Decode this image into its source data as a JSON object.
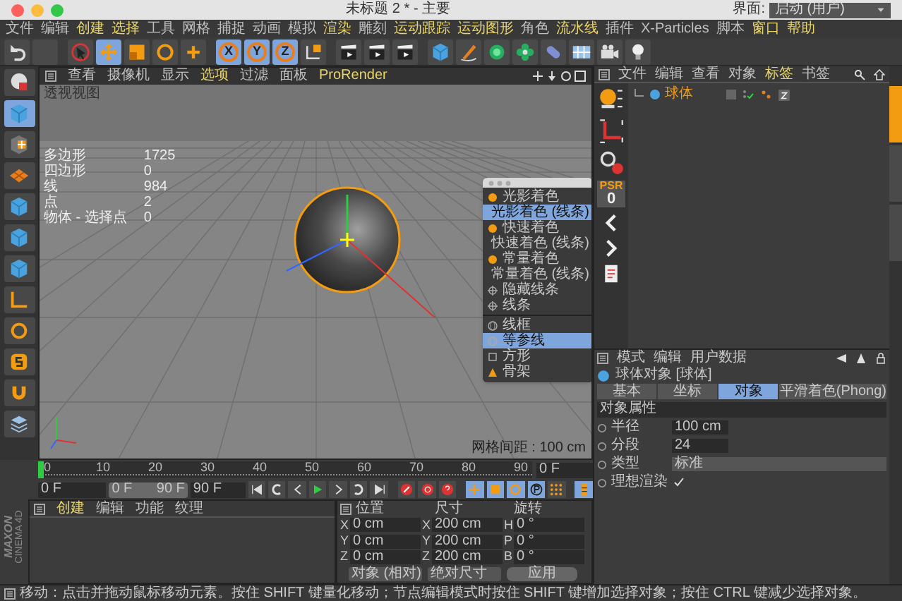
{
  "window": {
    "title": "未标题 2 * - 主要"
  },
  "menu": [
    {
      "label": "文件",
      "highlighted": false
    },
    {
      "label": "编辑",
      "highlighted": false
    },
    {
      "label": "创建",
      "highlighted": true
    },
    {
      "label": "选择",
      "highlighted": true
    },
    {
      "label": "工具",
      "highlighted": false
    },
    {
      "label": "网格",
      "highlighted": false
    },
    {
      "label": "捕捉",
      "highlighted": false
    },
    {
      "label": "动画",
      "highlighted": false
    },
    {
      "label": "模拟",
      "highlighted": false
    },
    {
      "label": "渲染",
      "highlighted": true
    },
    {
      "label": "雕刻",
      "highlighted": false
    },
    {
      "label": "运动跟踪",
      "highlighted": true
    },
    {
      "label": "运动图形",
      "highlighted": true
    },
    {
      "label": "角色",
      "highlighted": false
    },
    {
      "label": "流水线",
      "highlighted": true
    },
    {
      "label": "插件",
      "highlighted": false
    },
    {
      "label": "X-Particles",
      "highlighted": false
    },
    {
      "label": "脚本",
      "highlighted": false
    },
    {
      "label": "窗口",
      "highlighted": true
    },
    {
      "label": "帮助",
      "highlighted": true
    }
  ],
  "layout": {
    "label": "界面:",
    "value": "启动 (用户)"
  },
  "toolbar": [
    {
      "kind": "undo",
      "selected": false
    },
    {
      "kind": "blank",
      "selected": false
    },
    {
      "kind": "select",
      "selected": false
    },
    {
      "kind": "move",
      "selected": true
    },
    {
      "kind": "scale",
      "selected": false
    },
    {
      "kind": "rotate",
      "selected": false
    },
    {
      "kind": "plus",
      "selected": false
    },
    {
      "kind": "letter",
      "label": "X",
      "selected": true
    },
    {
      "kind": "letter",
      "label": "Y",
      "selected": true
    },
    {
      "kind": "letter",
      "label": "Z",
      "selected": true
    },
    {
      "kind": "coord",
      "selected": false
    },
    {
      "kind": "clapper",
      "selected": false
    },
    {
      "kind": "clapper",
      "selected": false
    },
    {
      "kind": "clapper",
      "selected": false
    },
    {
      "kind": "cube",
      "selected": false
    },
    {
      "kind": "pen",
      "selected": false
    },
    {
      "kind": "gem",
      "selected": false
    },
    {
      "kind": "flower",
      "selected": false
    },
    {
      "kind": "capsule",
      "selected": false
    },
    {
      "kind": "floor",
      "selected": false
    },
    {
      "kind": "camera",
      "selected": false
    },
    {
      "kind": "bulb",
      "selected": false
    }
  ],
  "tools": [
    {
      "kind": "model",
      "selected": false
    },
    {
      "kind": "cube",
      "selected": true
    },
    {
      "kind": "checker",
      "selected": false
    },
    {
      "kind": "grid",
      "selected": false
    },
    {
      "kind": "cube",
      "selected": false
    },
    {
      "kind": "cube",
      "selected": false
    },
    {
      "kind": "cube",
      "selected": false
    },
    {
      "kind": "axis",
      "selected": false
    },
    {
      "kind": "circle",
      "selected": false
    },
    {
      "kind": "snap",
      "selected": false
    },
    {
      "kind": "magnet",
      "selected": false
    },
    {
      "kind": "stack",
      "selected": false
    }
  ],
  "viewport": {
    "menu": [
      {
        "label": "查看",
        "highlighted": false
      },
      {
        "label": "摄像机",
        "highlighted": false
      },
      {
        "label": "显示",
        "highlighted": false
      },
      {
        "label": "选项",
        "highlighted": true
      },
      {
        "label": "过滤",
        "highlighted": false
      },
      {
        "label": "面板",
        "highlighted": false
      },
      {
        "label": "ProRender",
        "highlighted": true
      }
    ],
    "view_name": "透视视图",
    "stats": [
      {
        "label": "多边形",
        "value": "1725"
      },
      {
        "label": "四边形",
        "value": "0"
      },
      {
        "label": "线",
        "value": "984"
      },
      {
        "label": "点",
        "value": "2"
      },
      {
        "label": "物体 - 选择点",
        "value": "0"
      }
    ],
    "grid_spacing": "网格间距 : 100 cm",
    "shading_menu": [
      {
        "label": "光影着色",
        "kind": "dot",
        "selected": false
      },
      {
        "label": "光影着色 (线条)",
        "kind": "dot",
        "selected": true
      },
      {
        "label": "快速着色",
        "kind": "dot",
        "selected": false
      },
      {
        "label": "快速着色 (线条)",
        "kind": "dot",
        "selected": false
      },
      {
        "label": "常量着色",
        "kind": "dot",
        "selected": false
      },
      {
        "label": "常量着色 (线条)",
        "kind": "dot",
        "selected": false
      },
      {
        "label": "隐藏线条",
        "kind": "cross",
        "selected": false
      },
      {
        "label": "线条",
        "kind": "cross",
        "selected": false
      },
      {
        "label": "线框",
        "kind": "wire",
        "selected": false
      },
      {
        "label": "等参线",
        "kind": "wire",
        "selected": true
      },
      {
        "label": "方形",
        "kind": "box",
        "selected": false
      },
      {
        "label": "骨架",
        "kind": "bone",
        "selected": false
      }
    ]
  },
  "object_manager": {
    "menu": [
      {
        "label": "文件",
        "highlighted": false
      },
      {
        "label": "编辑",
        "highlighted": false
      },
      {
        "label": "查看",
        "highlighted": false
      },
      {
        "label": "对象",
        "highlighted": false
      },
      {
        "label": "标签",
        "highlighted": true
      },
      {
        "label": "书签",
        "highlighted": false
      }
    ],
    "objects": [
      {
        "name": "球体"
      }
    ],
    "psr_label": "PSR",
    "psr_value": "0"
  },
  "attributes": {
    "menu": [
      "模式",
      "编辑",
      "用户数据"
    ],
    "object_title": "球体对象 [球体]",
    "tabs": [
      {
        "label": "基本",
        "selected": false
      },
      {
        "label": "坐标",
        "selected": false
      },
      {
        "label": "对象",
        "selected": true
      },
      {
        "label": "平滑着色(Phong)",
        "selected": false
      }
    ],
    "section": "对象属性",
    "fields": [
      {
        "kind": "number",
        "label": "半径",
        "value": "100 cm"
      },
      {
        "kind": "number",
        "label": "分段",
        "value": "24"
      },
      {
        "kind": "select",
        "label": "类型",
        "value": "标准"
      },
      {
        "kind": "check",
        "label": "理想渲染",
        "checked": true
      }
    ]
  },
  "timeline": {
    "ticks": [
      "0",
      "10",
      "20",
      "30",
      "40",
      "50",
      "60",
      "70",
      "80",
      "90"
    ],
    "current": "0 F"
  },
  "transport": {
    "start": "0 F",
    "range": {
      "start": "0 F",
      "end": "90 F",
      "level": 1
    },
    "end": "90 F",
    "buttons": [
      {
        "kind": "first",
        "on": false
      },
      {
        "kind": "prevkey",
        "on": false
      },
      {
        "kind": "prev",
        "on": false
      },
      {
        "kind": "play",
        "on": false
      },
      {
        "kind": "next",
        "on": false
      },
      {
        "kind": "nextkey",
        "on": false
      },
      {
        "kind": "last",
        "on": false
      },
      {
        "kind": "record",
        "on": false
      },
      {
        "kind": "autokey",
        "on": false
      },
      {
        "kind": "help",
        "on": false
      },
      {
        "kind": "move",
        "on": true
      },
      {
        "kind": "scale",
        "on": true
      },
      {
        "kind": "rotate",
        "on": true
      },
      {
        "kind": "p",
        "on": true
      },
      {
        "kind": "dots",
        "on": false
      },
      {
        "kind": "timeline",
        "on": true
      }
    ]
  },
  "side_tabs": [
    {
      "selected": true
    },
    {
      "selected": false
    },
    {
      "selected": false
    }
  ],
  "logo": {
    "brand": "MAXON",
    "product": "CINEMA 4D"
  },
  "material_manager": {
    "menu": [
      {
        "label": "创建",
        "highlighted": true
      },
      {
        "label": "编辑",
        "highlighted": false
      },
      {
        "label": "功能",
        "highlighted": false
      },
      {
        "label": "纹理",
        "highlighted": false
      }
    ]
  },
  "coordinates": {
    "headers": [
      "位置",
      "尺寸",
      "旋转"
    ],
    "rows": [
      [
        "X",
        "0 cm",
        "X",
        "200 cm",
        "H",
        "0 °"
      ],
      [
        "Y",
        "0 cm",
        "Y",
        "200 cm",
        "P",
        "0 °"
      ],
      [
        "Z",
        "0 cm",
        "Z",
        "200 cm",
        "B",
        "0 °"
      ]
    ],
    "mode": "对象 (相对)",
    "size_mode": "绝对尺寸",
    "apply": "应用"
  },
  "status_bar": "移动：点击并拖动鼠标移动元素。按住 SHIFT 键量化移动；节点编辑模式时按住 SHIFT 键增加选择对象；按住 CTRL 键减少选择对象。"
}
